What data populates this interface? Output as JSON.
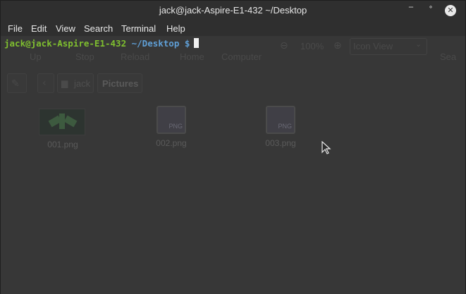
{
  "window": {
    "title": "jack@jack-Aspire-E1-432 ~/Desktop",
    "minimize_glyph": "‾",
    "maximize_glyph": "˚",
    "close_glyph": "✕"
  },
  "menu": [
    "File",
    "Edit",
    "View",
    "Search",
    "Terminal",
    "Help"
  ],
  "terminal": {
    "user_host": "jack@jack-Aspire-E1-432",
    "cwd": "~/Desktop",
    "prompt_symbol": "$"
  },
  "background_file_manager": {
    "toolbar": [
      "Up",
      "Stop",
      "Reload",
      "Home",
      "Computer"
    ],
    "zoom": "100%",
    "view_mode": "Icon View",
    "search_label": "Sea",
    "breadcrumb": [
      "jack",
      "Pictures"
    ],
    "files": [
      {
        "name": "001.png",
        "thumb_badge": ""
      },
      {
        "name": "002.png",
        "thumb_badge": "PNG"
      },
      {
        "name": "003.png",
        "thumb_badge": "PNG"
      }
    ]
  },
  "colors": {
    "user_host": "#7fbf2f",
    "path": "#5f9fd6",
    "cursor": "#f0f0f0",
    "background": "#373737"
  },
  "icons": [
    "minimize-icon",
    "maximize-icon",
    "close-icon",
    "mouse-pointer-icon",
    "folder-icon",
    "back-icon",
    "zoom-out-icon",
    "zoom-in-icon",
    "chevron-down-icon",
    "edit-icon"
  ]
}
